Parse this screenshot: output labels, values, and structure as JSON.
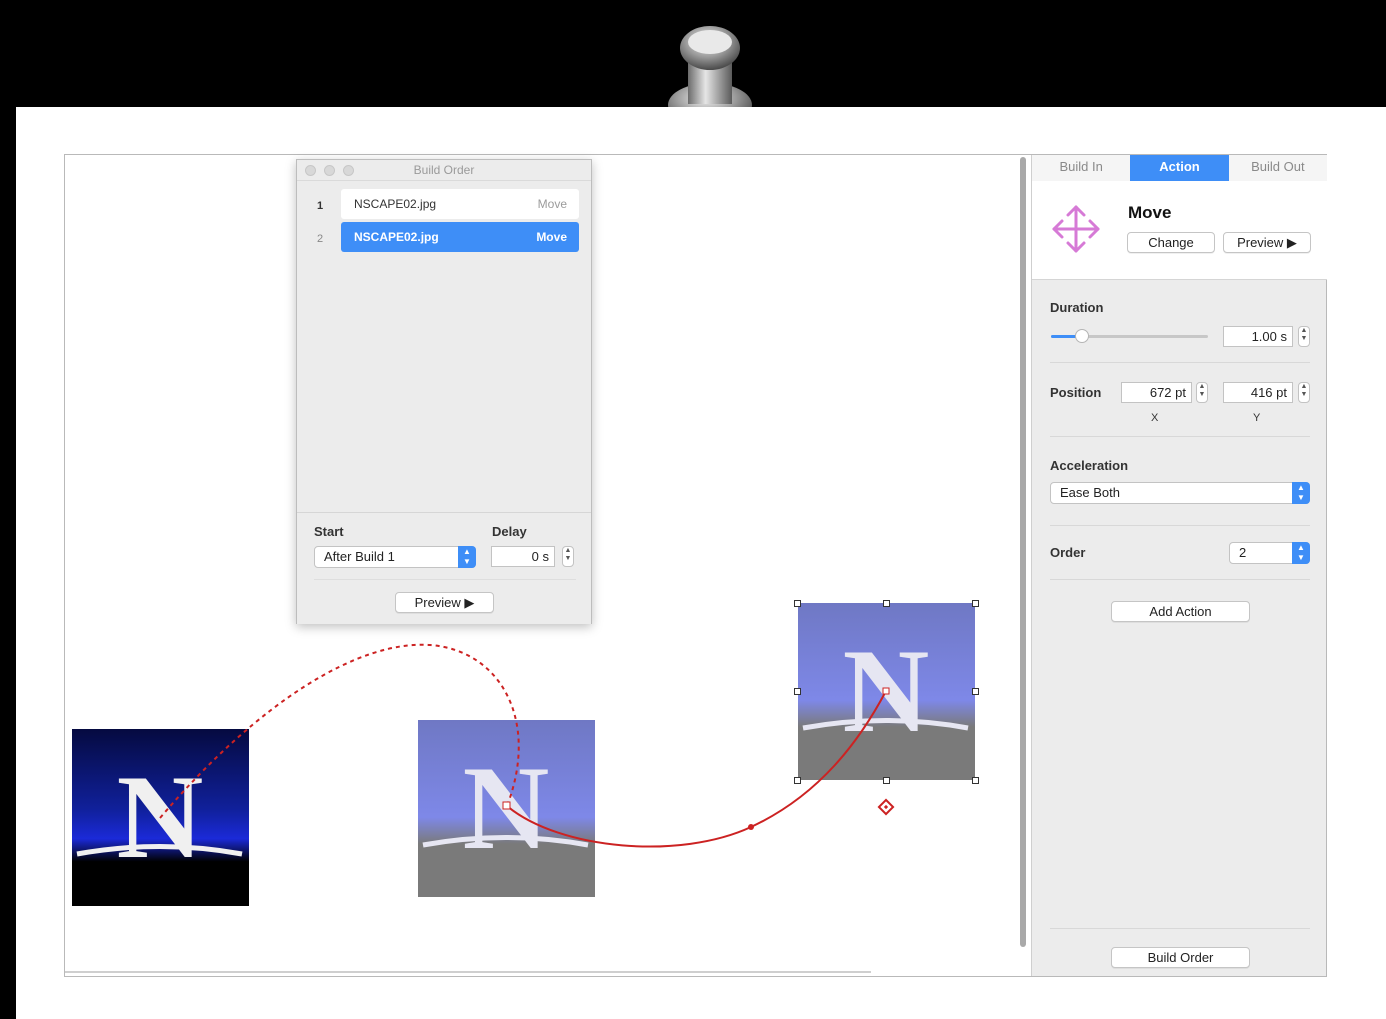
{
  "inspector": {
    "tabs": [
      "Build In",
      "Action",
      "Build Out"
    ],
    "action_title": "Move",
    "change_label": "Change",
    "preview_label": "Preview ▶",
    "duration_label": "Duration",
    "duration_value": "1.00 s",
    "duration_slider_fraction": 0.2,
    "position_label": "Position",
    "position_x": "672 pt",
    "position_y": "416 pt",
    "x_label": "X",
    "y_label": "Y",
    "acceleration_label": "Acceleration",
    "acceleration_value": "Ease Both",
    "order_label": "Order",
    "order_value": "2",
    "add_action_label": "Add Action",
    "build_order_label": "Build Order"
  },
  "build_order": {
    "title": "Build Order",
    "rows": [
      {
        "num": "1",
        "name": "NSCAPE02.jpg",
        "action": "Move",
        "selected": false
      },
      {
        "num": "2",
        "name": "NSCAPE02.jpg",
        "action": "Move",
        "selected": true
      }
    ],
    "start_label": "Start",
    "start_value": "After Build 1",
    "delay_label": "Delay",
    "delay_value": "0 s",
    "preview_label": "Preview ▶"
  },
  "canvas": {
    "image_letter": "N"
  },
  "colors": {
    "accent": "#3e8ef7",
    "path_red": "#cc2222",
    "move_icon": "#d67ad6"
  }
}
